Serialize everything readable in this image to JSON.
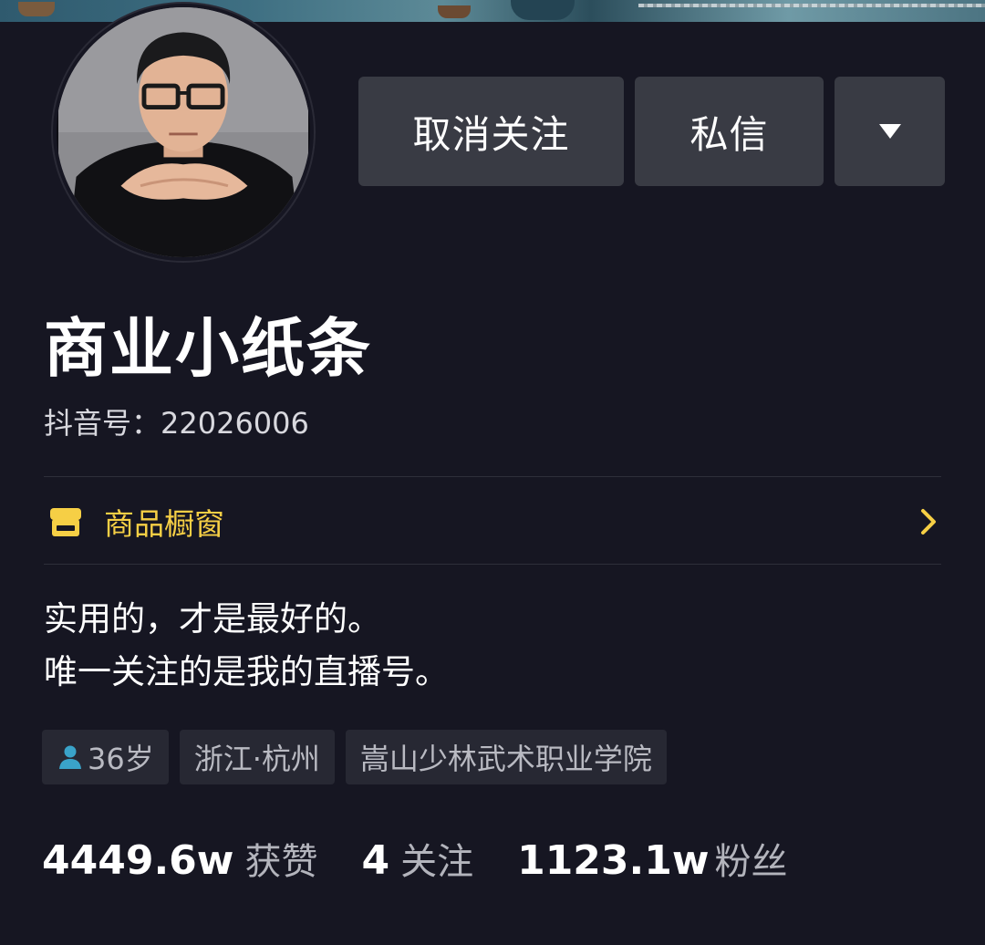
{
  "profile": {
    "name": "商业小纸条",
    "douyin_id": "抖音号：22026006",
    "avatar_icon": "user-avatar-photo"
  },
  "actions": {
    "unfollow_label": "取消关注",
    "message_label": "私信",
    "more_icon": "triangle-down-icon"
  },
  "shop": {
    "label": "商品橱窗",
    "icon": "shop-window-icon",
    "accent_color": "#f6cf45"
  },
  "bio": {
    "line1": "实用的，才是最好的。",
    "line2": "唯一关注的是我的直播号。"
  },
  "tags": {
    "age": "36岁",
    "location": "浙江·杭州",
    "school": "嵩山少林武术职业学院"
  },
  "stats": {
    "likes_value": "4449.6w",
    "likes_label": "获赞",
    "following_value": "4",
    "following_label": "关注",
    "followers_value": "1123.1w",
    "followers_label": "粉丝"
  }
}
